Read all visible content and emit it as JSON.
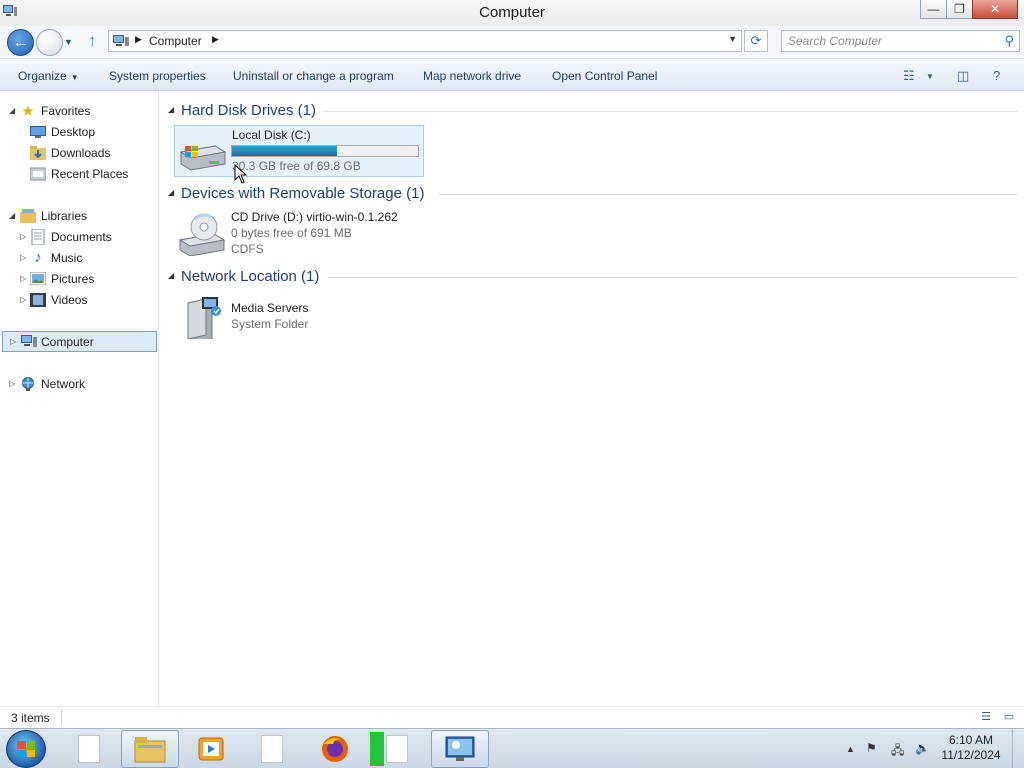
{
  "window": {
    "title": "Computer",
    "minimize_label": "—",
    "restore_label": "❐",
    "close_label": "✕"
  },
  "address": {
    "crumb": "Computer",
    "search_placeholder": "Search Computer"
  },
  "toolbar": {
    "organize": "Organize",
    "system_properties": "System properties",
    "uninstall": "Uninstall or change a program",
    "map_drive": "Map network drive",
    "control_panel": "Open Control Panel"
  },
  "sidebar": {
    "favorites": "Favorites",
    "desktop": "Desktop",
    "downloads": "Downloads",
    "recent_places": "Recent Places",
    "libraries": "Libraries",
    "documents": "Documents",
    "music": "Music",
    "pictures": "Pictures",
    "videos": "Videos",
    "computer": "Computer",
    "network": "Network"
  },
  "groups": {
    "hard_disks": {
      "title": "Hard Disk Drives (1)",
      "local_disk": {
        "name": "Local Disk (C:)",
        "free_text": "30.3 GB free of 69.8 GB",
        "used_fraction": 0.566
      }
    },
    "removable": {
      "title": "Devices with Removable Storage (1)",
      "cd_drive": {
        "name": "CD Drive (D:) virtio-win-0.1.262",
        "free_text": "0 bytes free of 691 MB",
        "fs": "CDFS"
      }
    },
    "network": {
      "title": "Network Location (1)",
      "media_servers": {
        "name": "Media Servers",
        "sub": "System Folder"
      }
    }
  },
  "status": {
    "item_count": "3 items"
  },
  "clock": {
    "time": "6:10 AM",
    "date": "11/12/2024"
  },
  "colors": {
    "accent": "#1e3f74",
    "selection": "#dcebfc",
    "bar_fill": "#2a86c4"
  }
}
